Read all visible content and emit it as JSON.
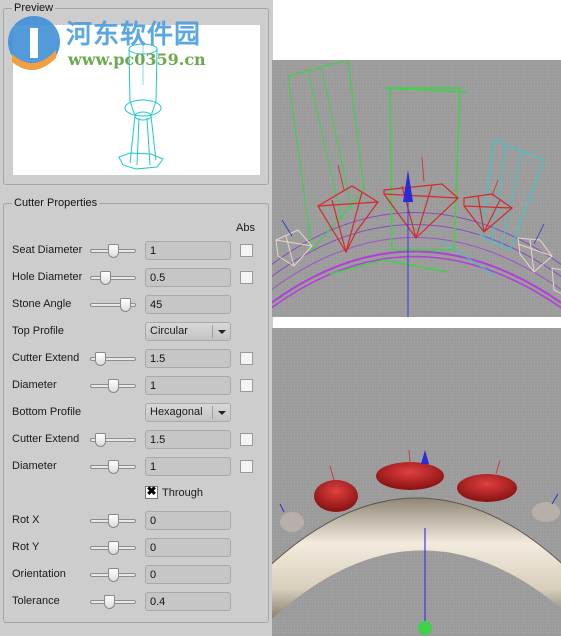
{
  "preview": {
    "title": "Preview"
  },
  "watermark": {
    "site_name": "河东软件园",
    "url": "www.pc0359.cn"
  },
  "cutter_properties": {
    "title": "Cutter Properties",
    "abs_header": "Abs",
    "rows": [
      {
        "type": "slider",
        "label": "Seat Diameter",
        "value": "1",
        "slider_fraction": 0.5,
        "has_abs": true,
        "abs_checked": false
      },
      {
        "type": "slider",
        "label": "Hole Diameter",
        "value": "0.5",
        "slider_fraction": 0.3,
        "has_abs": true,
        "abs_checked": false
      },
      {
        "type": "slider",
        "label": "Stone Angle",
        "value": "45",
        "slider_fraction": 0.82,
        "has_abs": false
      },
      {
        "type": "combo",
        "label": "Top Profile",
        "value": "Circular"
      },
      {
        "type": "slider",
        "label": "Cutter Extend",
        "value": "1.5",
        "slider_fraction": 0.15,
        "has_abs": true,
        "abs_checked": false
      },
      {
        "type": "slider",
        "label": "Diameter",
        "value": "1",
        "slider_fraction": 0.5,
        "has_abs": true,
        "abs_checked": false
      },
      {
        "type": "combo",
        "label": "Bottom Profile",
        "value": "Hexagonal"
      },
      {
        "type": "slider",
        "label": "Cutter Extend",
        "value": "1.5",
        "slider_fraction": 0.15,
        "has_abs": true,
        "abs_checked": false
      },
      {
        "type": "slider",
        "label": "Diameter",
        "value": "1",
        "slider_fraction": 0.5,
        "has_abs": true,
        "abs_checked": false
      },
      {
        "type": "check",
        "label": "Through",
        "checked": true
      },
      {
        "type": "slider",
        "label": "Rot X",
        "value": "0",
        "slider_fraction": 0.5,
        "has_abs": false
      },
      {
        "type": "slider",
        "label": "Rot Y",
        "value": "0",
        "slider_fraction": 0.5,
        "has_abs": false
      },
      {
        "type": "slider",
        "label": "Orientation",
        "value": "0",
        "slider_fraction": 0.5,
        "has_abs": false
      },
      {
        "type": "slider",
        "label": "Tolerance",
        "value": "0.4",
        "slider_fraction": 0.4,
        "has_abs": false
      }
    ]
  },
  "viewports": {
    "top": {
      "mode": "wireframe"
    },
    "bottom": {
      "mode": "shaded"
    }
  },
  "colors": {
    "panel_bg": "#cdcdcd",
    "viewport_bg": "#9a9a9a",
    "cutter_selected": "#3fd14a",
    "cutter_other": "#3cc7c7",
    "stone_selected": "#d42a2a",
    "ring_wire": "#a34fd0",
    "axis_z": "#2a2ad8",
    "metal": "#e8dcc8"
  }
}
